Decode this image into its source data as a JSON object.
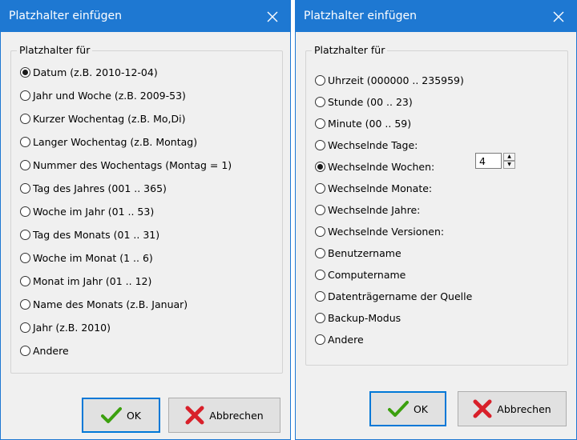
{
  "dialog_left": {
    "title": "Platzhalter einfügen",
    "group_label": "Platzhalter für",
    "options": [
      "Datum (z.B. 2010-12-04)",
      "Jahr und Woche (z.B. 2009-53)",
      "Kurzer Wochentag (z.B. Mo,Di)",
      "Langer Wochentag (z.B. Montag)",
      "Nummer des Wochentags (Montag = 1)",
      "Tag des Jahres (001 .. 365)",
      "Woche im Jahr (01 .. 53)",
      "Tag des Monats (01 .. 31)",
      "Woche im Monat (1 .. 6)",
      "Monat im Jahr (01 .. 12)",
      "Name des Monats (z.B. Januar)",
      "Jahr (z.B. 2010)",
      "Andere"
    ],
    "selected_index": 0,
    "ok_label": "OK",
    "cancel_label": "Abbrechen"
  },
  "dialog_right": {
    "title": "Platzhalter einfügen",
    "group_label": "Platzhalter für",
    "options": [
      "Uhrzeit (000000 .. 235959)",
      "Stunde (00 .. 23)",
      "Minute (00 .. 59)",
      "Wechselnde Tage:",
      "Wechselnde Wochen:",
      "Wechselnde Monate:",
      "Wechselnde Jahre:",
      "Wechselnde Versionen:",
      "Benutzername",
      "Computername",
      "Datenträgername der Quelle",
      "Backup-Modus",
      "Andere"
    ],
    "selected_index": 4,
    "weeks_value": "4",
    "ok_label": "OK",
    "cancel_label": "Abbrechen"
  },
  "colors": {
    "titlebar": "#1e78d2",
    "dialog_bg": "#f0f0f0",
    "ok_check": "#3ca00f",
    "cancel_x": "#d8202a"
  },
  "icons": {
    "close": "close-icon",
    "ok": "checkmark-icon",
    "cancel": "red-x-icon"
  }
}
